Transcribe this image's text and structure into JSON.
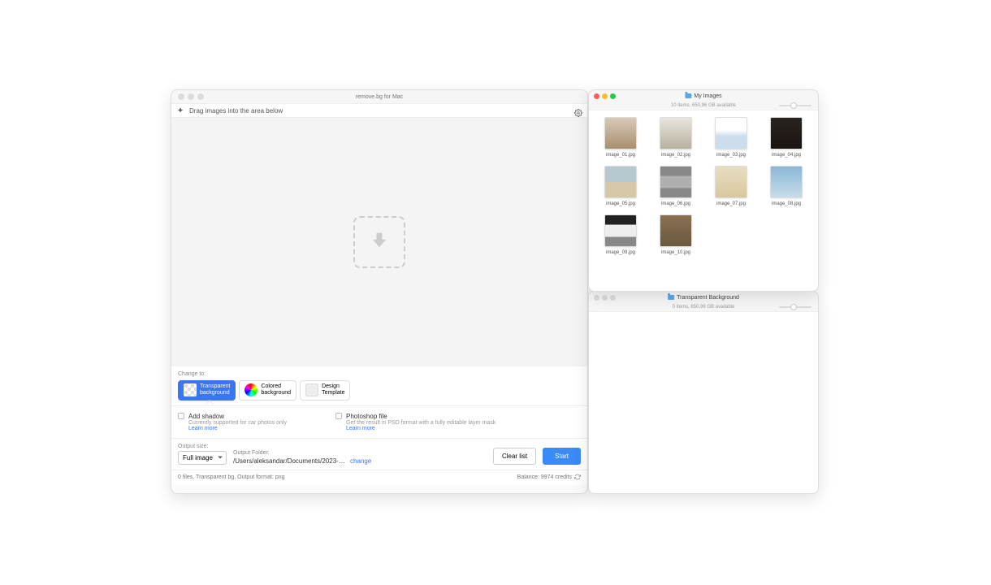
{
  "main": {
    "title": "remove.bg for Mac",
    "drag_hint": "Drag images into the area below",
    "change_label": "Change to:",
    "tabs": [
      {
        "line1": "Transparent",
        "line2": "background"
      },
      {
        "line1": "Colored",
        "line2": "background"
      },
      {
        "line1": "Design",
        "line2": "Template"
      }
    ],
    "options": {
      "shadow": {
        "title": "Add shadow",
        "sub": "Currently supported for car photos only",
        "learn": "Learn more"
      },
      "psd": {
        "title": "Photoshop file",
        "sub": "Get the result in PSD format with a fully editable layer mask",
        "learn": "Learn more"
      }
    },
    "output": {
      "size_label": "Output size:",
      "size_value": "Full image",
      "folder_label": "Output Folder:",
      "folder_path": "/Users/aleksandar/Documents/2023-04-0…",
      "change": "change",
      "clear": "Clear list",
      "start": "Start"
    },
    "status": {
      "left": "0 files, Transparent bg, Output format: png",
      "right": "Balance: 9974 credits"
    }
  },
  "finder1": {
    "title": "My Images",
    "sub": "10 items, 650,96 GB available",
    "items": [
      {
        "name": "image_01.jpg",
        "cls": "t1"
      },
      {
        "name": "image_02.jpg",
        "cls": "t2"
      },
      {
        "name": "image_03.jpg",
        "cls": "t3"
      },
      {
        "name": "image_04.jpg",
        "cls": "t4"
      },
      {
        "name": "image_05.jpg",
        "cls": "t5"
      },
      {
        "name": "image_06.jpg",
        "cls": "t6"
      },
      {
        "name": "image_07.jpg",
        "cls": "t7"
      },
      {
        "name": "image_08.jpg",
        "cls": "t8"
      },
      {
        "name": "image_09.jpg",
        "cls": "t9"
      },
      {
        "name": "image_10.jpg",
        "cls": "t10"
      }
    ]
  },
  "finder2": {
    "title": "Transparent Background",
    "sub": "0 items, 650,96 GB available"
  }
}
